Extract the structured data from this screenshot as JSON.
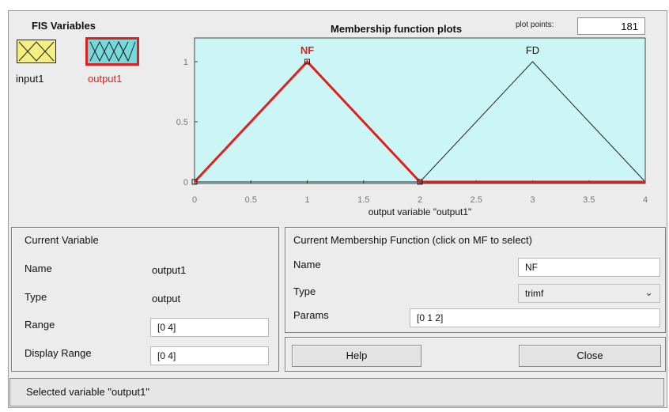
{
  "fis_variables": {
    "title": "FIS Variables",
    "inputs": [
      {
        "label": "input1"
      }
    ],
    "outputs": [
      {
        "label": "output1",
        "selected": true
      }
    ]
  },
  "plot": {
    "title": "Membership function plots",
    "plot_points_label": "plot points:",
    "plot_points_value": "181",
    "xlabel": "output variable \"output1\"",
    "background": "#ccf5f5",
    "x_ticks": [
      "0",
      "0.5",
      "1",
      "1.5",
      "2",
      "2.5",
      "3",
      "3.5",
      "4"
    ],
    "y_ticks": [
      "0",
      "0.5",
      "1"
    ],
    "xlim": [
      0,
      4
    ],
    "ylim": [
      0,
      1.08
    ],
    "membership_functions": [
      {
        "name": "NF",
        "type": "trimf",
        "params": [
          0,
          1,
          2
        ],
        "selected": true,
        "color": "#e02020"
      },
      {
        "name": "FD",
        "type": "trimf",
        "params": [
          2,
          3,
          4
        ],
        "selected": false,
        "color": "#222222"
      }
    ]
  },
  "current_variable": {
    "title": "Current Variable",
    "name_label": "Name",
    "name_value": "output1",
    "type_label": "Type",
    "type_value": "output",
    "range_label": "Range",
    "range_value": "[0 4]",
    "display_range_label": "Display Range",
    "display_range_value": "[0 4]"
  },
  "current_mf": {
    "title": "Current Membership Function (click on MF to select)",
    "name_label": "Name",
    "name_value": "NF",
    "type_label": "Type",
    "type_value": "trimf",
    "params_label": "Params",
    "params_value": "[0 1 2]"
  },
  "buttons": {
    "help": "Help",
    "close": "Close"
  },
  "status": "Selected variable \"output1\"",
  "colors": {
    "input_box": "#f5ee80",
    "output_box": "#77d9d9",
    "selected_border": "#e02020"
  }
}
